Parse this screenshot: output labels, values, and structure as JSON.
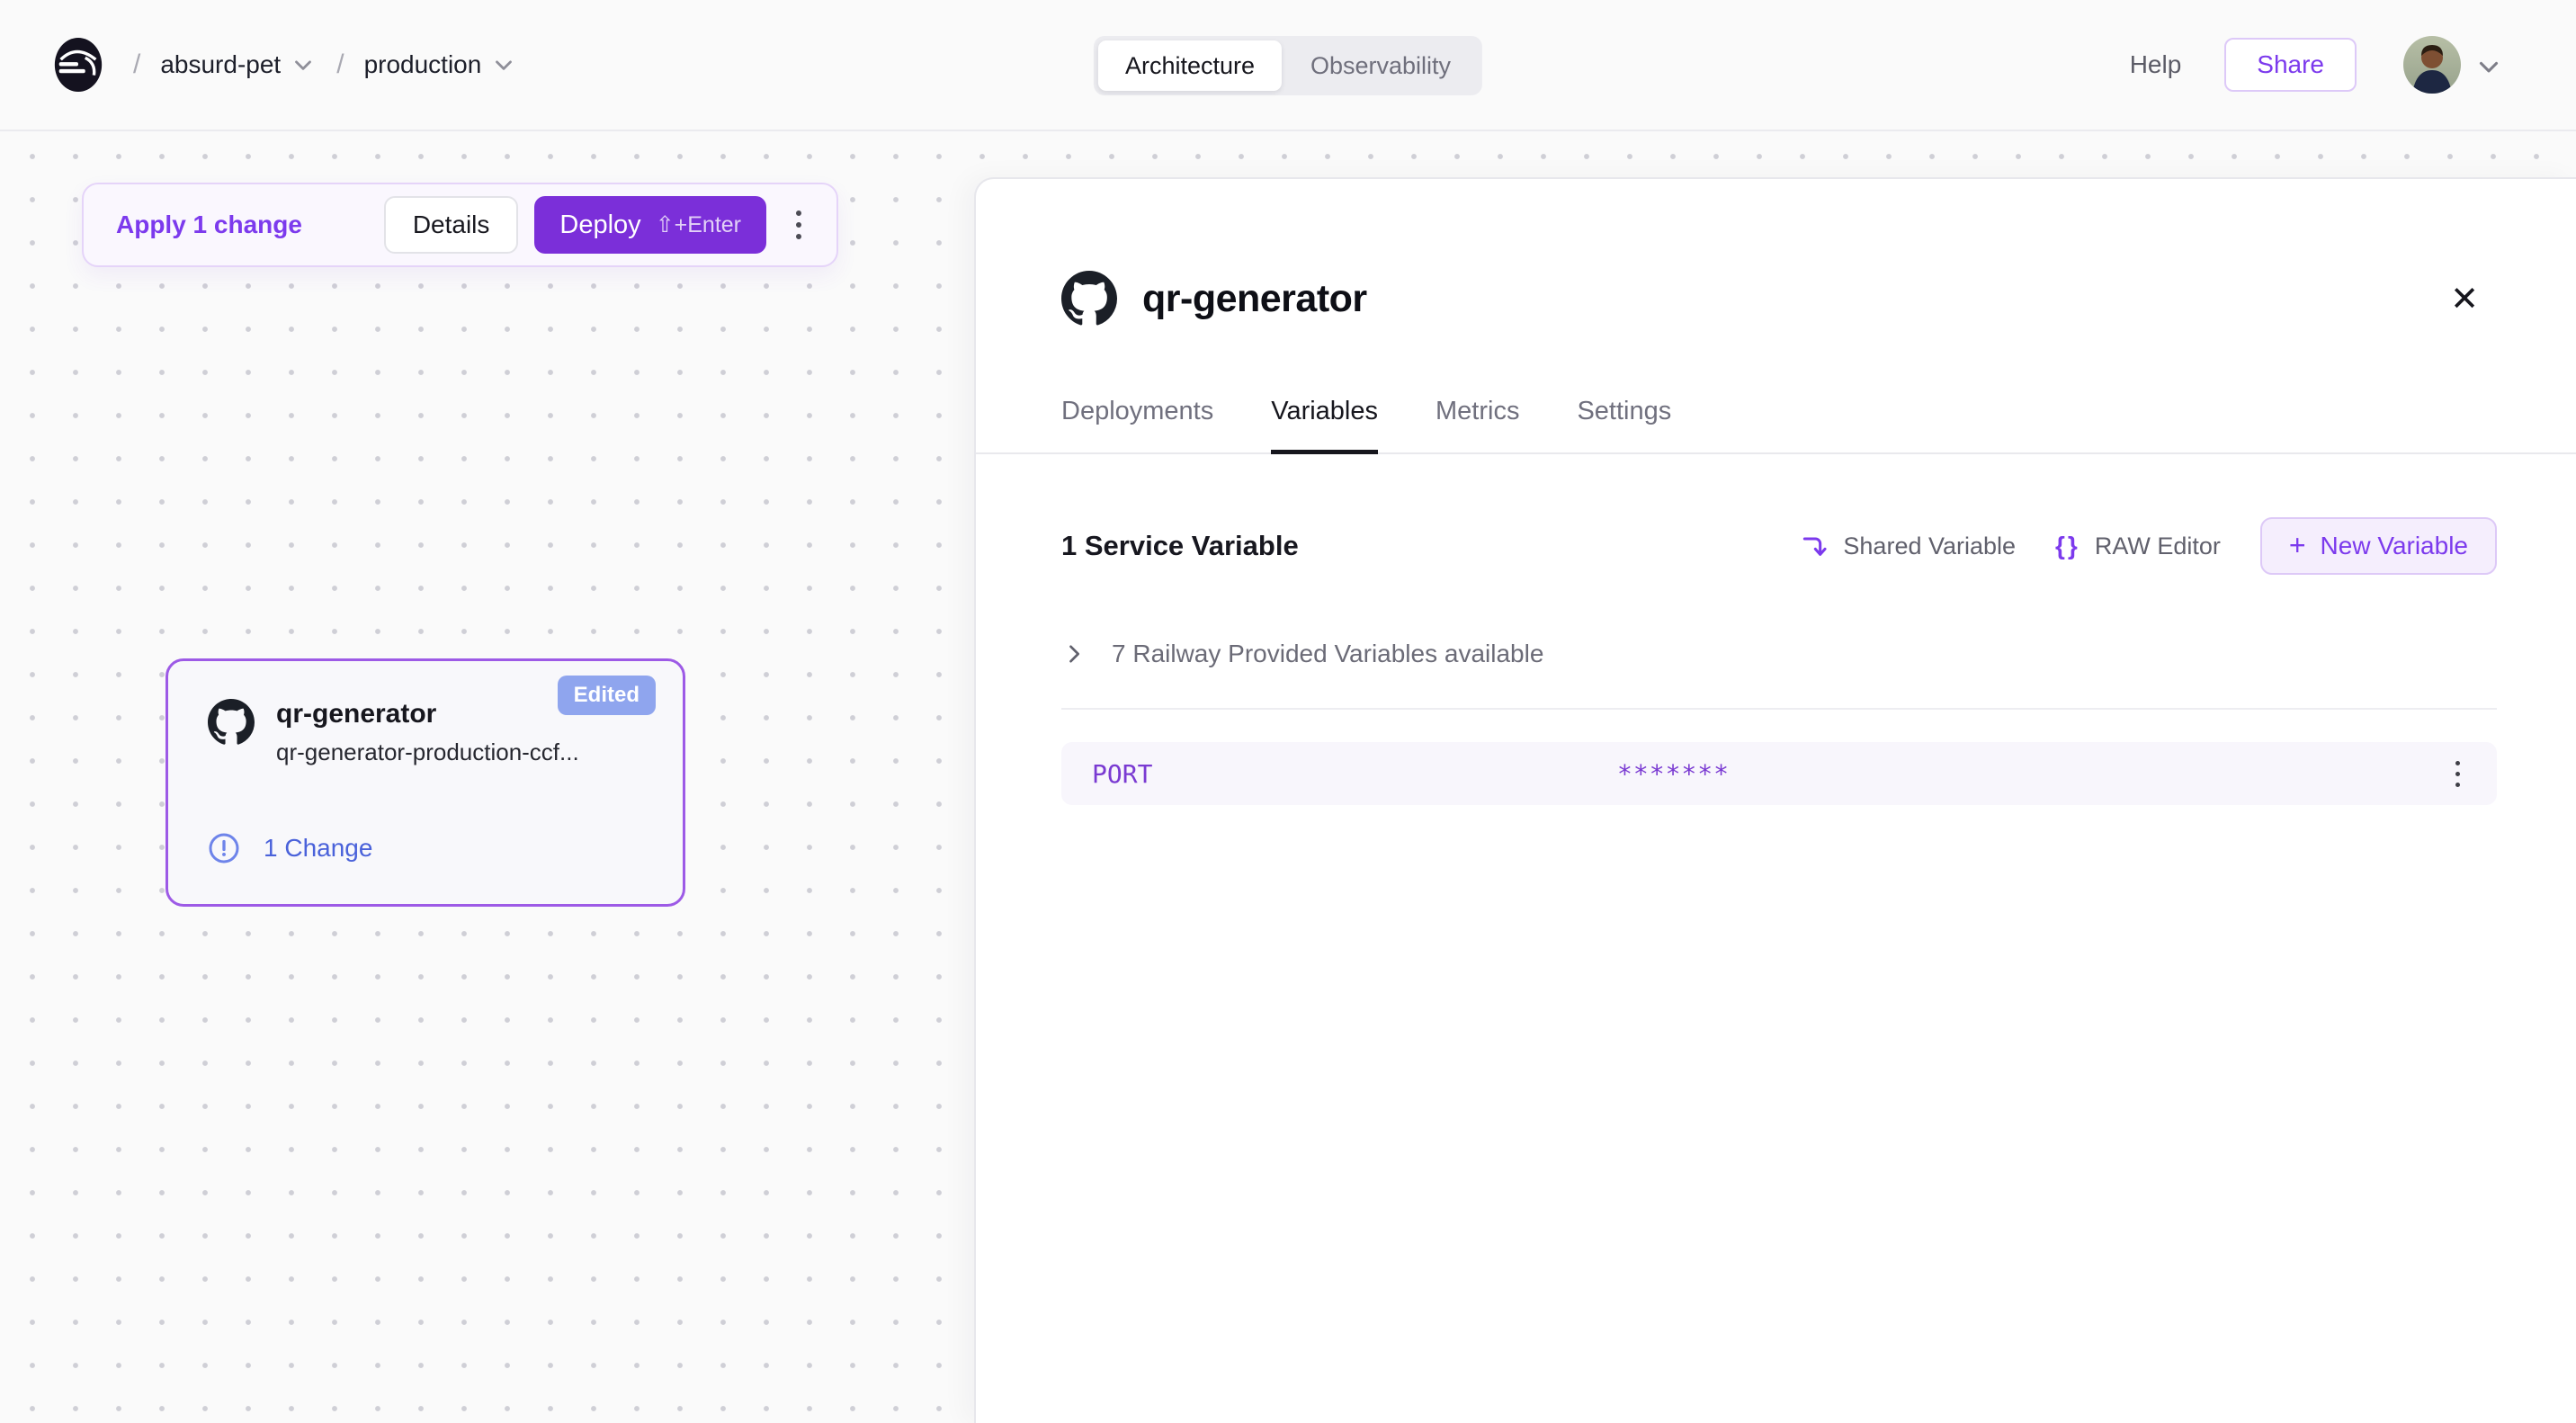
{
  "header": {
    "breadcrumb": {
      "separator": "/",
      "project": "absurd-pet",
      "environment": "production"
    },
    "view_toggle": {
      "architecture": "Architecture",
      "observability": "Observability",
      "active": "Architecture"
    },
    "help_label": "Help",
    "share_label": "Share"
  },
  "changes_bar": {
    "apply_label": "Apply 1 change",
    "details_label": "Details",
    "deploy_label": "Deploy",
    "deploy_shortcut": "⇧+Enter"
  },
  "service_card": {
    "badge": "Edited",
    "name": "qr-generator",
    "domain": "qr-generator-production-ccf...",
    "changes_label": "1 Change"
  },
  "panel": {
    "title": "qr-generator",
    "close_glyph": "✕",
    "tabs": [
      {
        "label": "Deployments",
        "active": false
      },
      {
        "label": "Variables",
        "active": true
      },
      {
        "label": "Metrics",
        "active": false
      },
      {
        "label": "Settings",
        "active": false
      }
    ],
    "variables": {
      "count_label": "1 Service Variable",
      "shared_variable_label": "Shared Variable",
      "raw_editor_label": "RAW Editor",
      "raw_editor_glyph": "{}",
      "new_variable_label": "New Variable",
      "new_variable_plus": "+",
      "provided_label": "7 Railway Provided Variables available",
      "rows": [
        {
          "key": "PORT",
          "value": "*******"
        }
      ]
    }
  },
  "colors": {
    "accent_purple": "#7c3aed",
    "deploy_purple": "#7b2fd9",
    "edited_badge_blue": "#8fa5ee",
    "change_blue": "#4a62da",
    "variable_purple": "#7a3ad2",
    "card_border_purple": "#9d5ae6",
    "panel_bg": "#ffffff",
    "canvas_bg": "#fafafa"
  }
}
